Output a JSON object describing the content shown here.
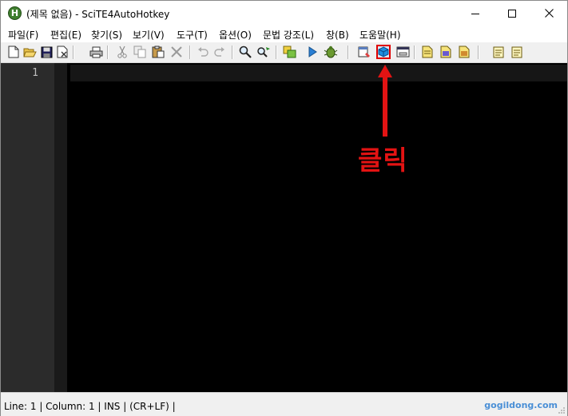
{
  "window": {
    "title": "(제목 없음) - SciTE4AutoHotkey",
    "icon": "autohotkey-h-icon"
  },
  "window_controls": {
    "minimize": "minimize-icon",
    "maximize": "maximize-icon",
    "close": "close-icon"
  },
  "menu": [
    {
      "label": "파일(F)"
    },
    {
      "label": "편집(E)"
    },
    {
      "label": "찾기(S)"
    },
    {
      "label": "보기(V)"
    },
    {
      "label": "도구(T)"
    },
    {
      "label": "옵션(O)"
    },
    {
      "label": "문법 강조(L)"
    },
    {
      "label": "창(B)"
    },
    {
      "label": "도움말(H)"
    }
  ],
  "toolbar": [
    {
      "icon": "new-file-icon"
    },
    {
      "icon": "open-folder-icon"
    },
    {
      "icon": "save-icon"
    },
    {
      "icon": "close-file-icon"
    },
    {
      "icon": "print-icon"
    },
    {
      "icon": "cut-icon"
    },
    {
      "icon": "copy-icon"
    },
    {
      "icon": "paste-icon"
    },
    {
      "icon": "delete-icon"
    },
    {
      "icon": "undo-icon"
    },
    {
      "icon": "redo-icon"
    },
    {
      "icon": "find-icon"
    },
    {
      "icon": "replace-icon"
    },
    {
      "icon": "compile-icon"
    },
    {
      "icon": "run-icon"
    },
    {
      "icon": "debug-icon"
    },
    {
      "icon": "smartgui-icon"
    },
    {
      "icon": "window-spy-icon",
      "highlighted": true
    },
    {
      "icon": "msgbox-creator-icon"
    },
    {
      "icon": "toolbar-properties-icon"
    },
    {
      "icon": "user-properties-icon"
    },
    {
      "icon": "global-properties-icon"
    },
    {
      "icon": "abbreviations-icon"
    },
    {
      "icon": "platform-properties-icon"
    }
  ],
  "editor": {
    "line_numbers": [
      "1"
    ],
    "background": "#000000",
    "gutter_color": "#2b2b2b"
  },
  "annotation": {
    "text": "클릭",
    "color": "#e31313"
  },
  "status": {
    "text": "Line: 1 | Column: 1 | INS | (CR+LF) |"
  },
  "watermark": {
    "text": "gogildong.com",
    "color": "#4a8fd6"
  }
}
